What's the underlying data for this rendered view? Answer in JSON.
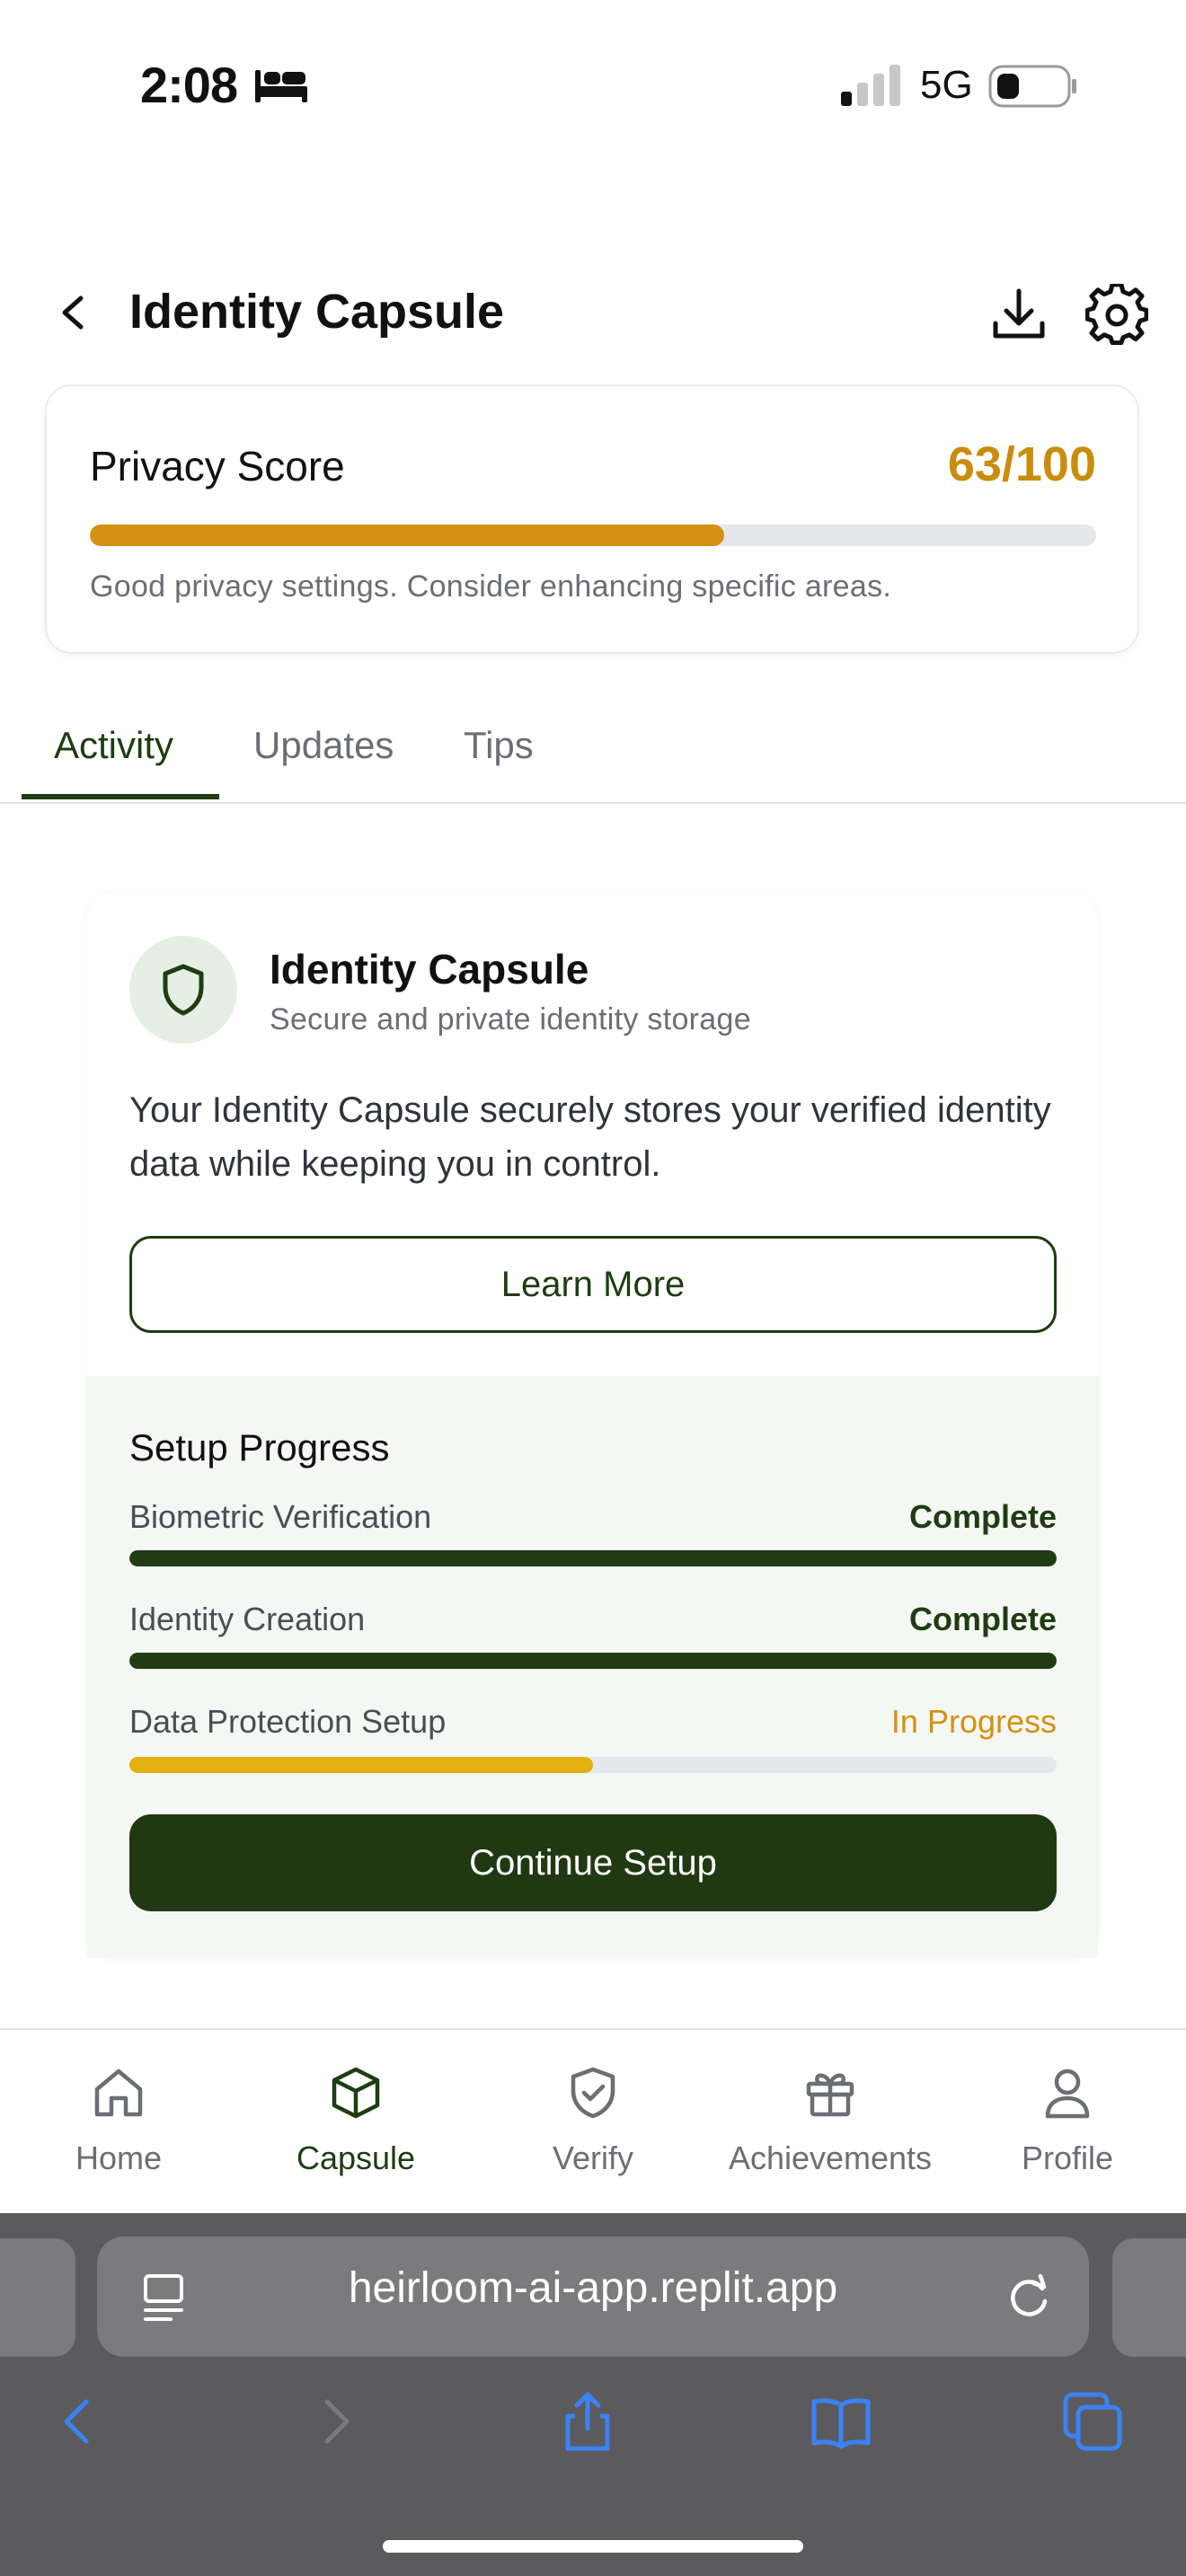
{
  "status_bar": {
    "time": "2:08",
    "network": "5G"
  },
  "header": {
    "title": "Identity Capsule"
  },
  "privacy": {
    "label": "Privacy Score",
    "score": "63/100",
    "score_fraction": 0.63,
    "note": "Good privacy settings. Consider enhancing specific areas."
  },
  "tabs": [
    {
      "label": "Activity",
      "active": true
    },
    {
      "label": "Updates",
      "active": false
    },
    {
      "label": "Tips",
      "active": false
    }
  ],
  "card": {
    "title": "Identity Capsule",
    "subtitle": "Secure and private identity storage",
    "body": "Your Identity Capsule securely stores your verified identity data while keeping you in control.",
    "learn_more": "Learn More"
  },
  "setup": {
    "heading": "Setup Progress",
    "steps": [
      {
        "label": "Biometric Verification",
        "status": "Complete",
        "progress": 1.0
      },
      {
        "label": "Identity Creation",
        "status": "Complete",
        "progress": 1.0
      },
      {
        "label": "Data Protection Setup",
        "status": "In Progress",
        "progress": 0.5
      }
    ],
    "continue": "Continue Setup"
  },
  "nav": [
    {
      "label": "Home",
      "icon": "home-icon"
    },
    {
      "label": "Capsule",
      "icon": "cube-icon",
      "active": true
    },
    {
      "label": "Verify",
      "icon": "shield-check-icon"
    },
    {
      "label": "Achievements",
      "icon": "gift-icon"
    },
    {
      "label": "Profile",
      "icon": "user-icon"
    }
  ],
  "browser": {
    "url": "heirloom-ai-app.replit.app"
  },
  "colors": {
    "accent": "#1f3c13",
    "score": "#c98d0e",
    "progress_yellow": "#e3b010",
    "browser_blue": "#3b82f6"
  }
}
